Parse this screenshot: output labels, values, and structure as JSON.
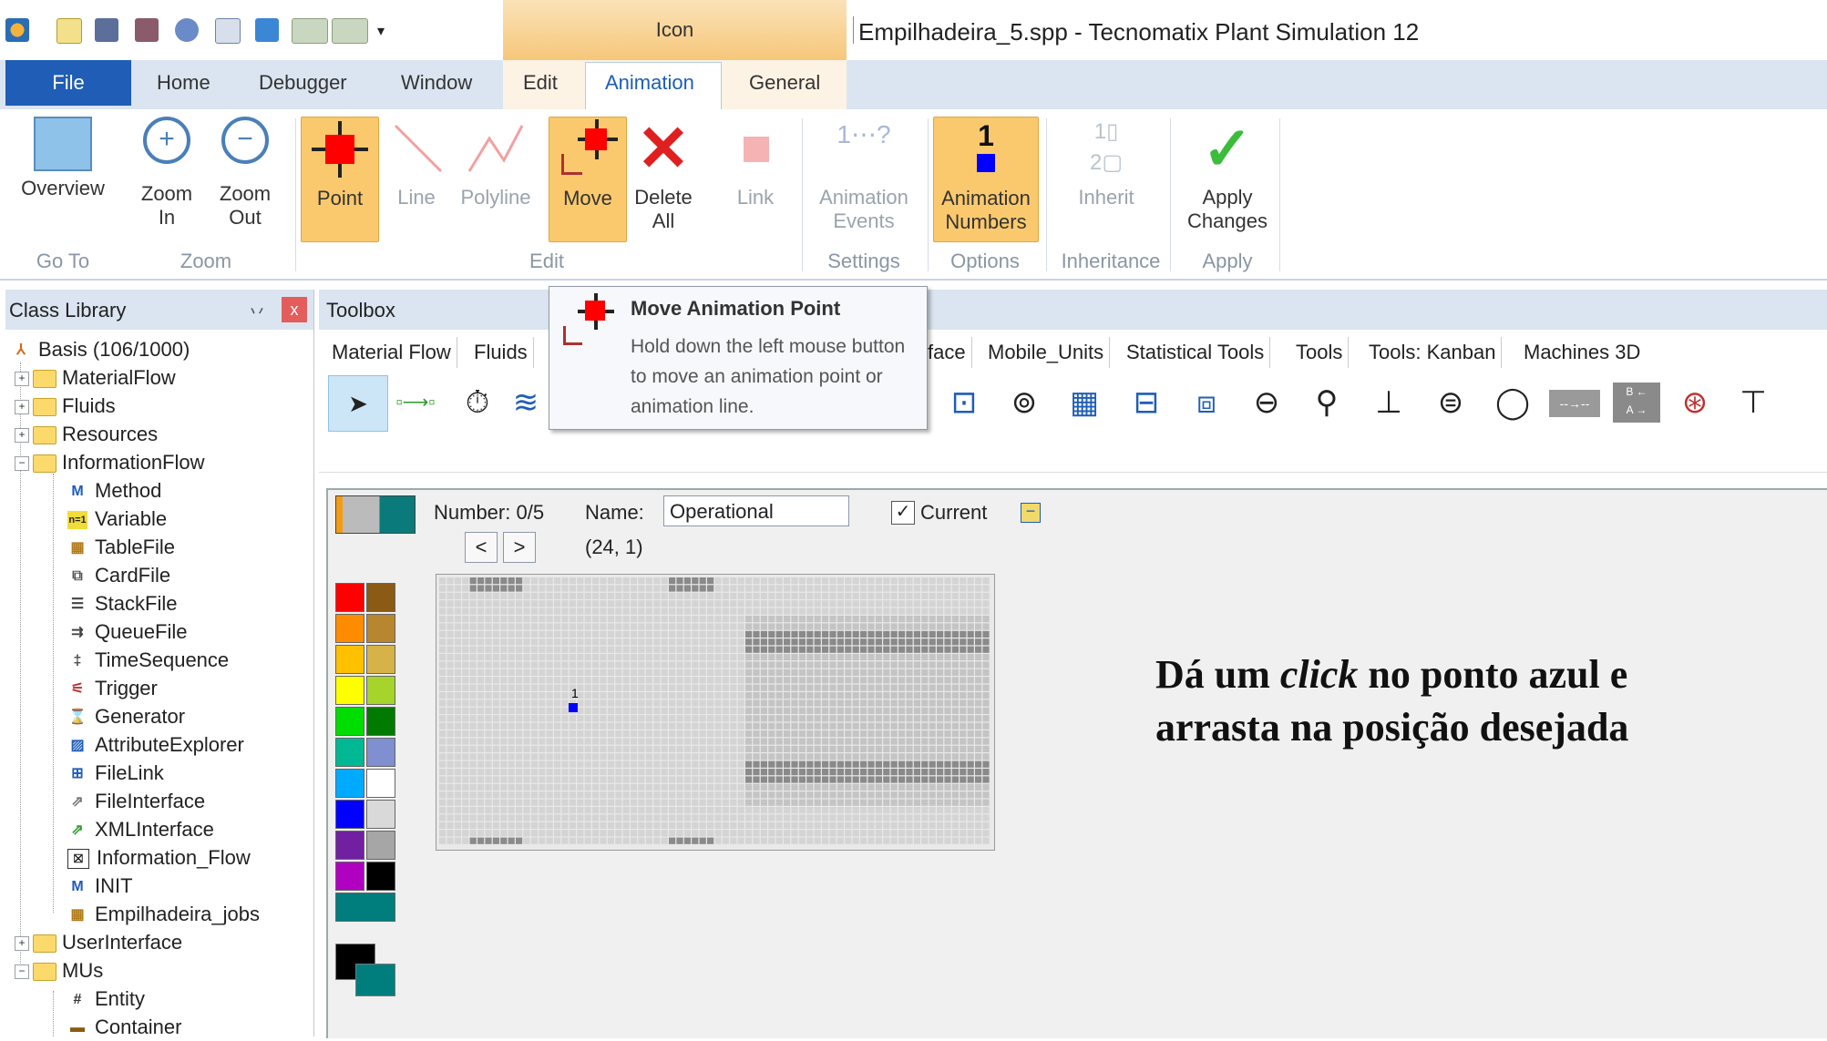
{
  "window": {
    "title": "Empilhadeira_5.spp - Tecnomatix Plant Simulation 12",
    "context_tab": "Icon"
  },
  "tabs": {
    "file": "File",
    "home": "Home",
    "debugger": "Debugger",
    "window": "Window",
    "edit": "Edit",
    "animation": "Animation",
    "general": "General"
  },
  "ribbon": {
    "overview": "Overview",
    "zoom_in_1": "Zoom",
    "zoom_in_2": "In",
    "zoom_out_1": "Zoom",
    "zoom_out_2": "Out",
    "point": "Point",
    "line": "Line",
    "polyline": "Polyline",
    "move": "Move",
    "delete_1": "Delete",
    "delete_2": "All",
    "link": "Link",
    "anim_events_1": "Animation",
    "anim_events_2": "Events",
    "anim_numbers_1": "Animation",
    "anim_numbers_2": "Numbers",
    "inherit": "Inherit",
    "apply_1": "Apply",
    "apply_2": "Changes",
    "groups": {
      "goto": "Go To",
      "zoom": "Zoom",
      "edit": "Edit",
      "settings": "Settings",
      "options": "Options",
      "inheritance": "Inheritance",
      "apply": "Apply"
    }
  },
  "class_library": {
    "title": "Class Library",
    "pin": "丷",
    "close": "x",
    "root": "Basis (106/1000)",
    "items": {
      "materialflow": "MaterialFlow",
      "fluids": "Fluids",
      "resources": "Resources",
      "informationflow": "InformationFlow",
      "method": "Method",
      "variable": "Variable",
      "tablefile": "TableFile",
      "cardfile": "CardFile",
      "stackfile": "StackFile",
      "queuefile": "QueueFile",
      "timesequence": "TimeSequence",
      "trigger": "Trigger",
      "generator": "Generator",
      "attributeexplorer": "AttributeExplorer",
      "filelink": "FileLink",
      "fileinterface": "FileInterface",
      "xmlinterface": "XMLInterface",
      "information_flow": "Information_Flow",
      "init": "INIT",
      "empilhadeira_jobs": "Empilhadeira_jobs",
      "userinterface": "UserInterface",
      "mus": "MUs",
      "entity": "Entity",
      "container": "Container"
    }
  },
  "toolbox": {
    "title": "Toolbox",
    "tabs": {
      "material_flow": "Material Flow",
      "fluids": "Fluids",
      "face": "face",
      "mobile_units": "Mobile_Units",
      "statistical_tools": "Statistical Tools",
      "tools": "Tools",
      "tools_kanban": "Tools: Kanban",
      "machines_3d": "Machines 3D"
    }
  },
  "tooltip": {
    "title": "Move Animation Point",
    "body": "Hold down the left mouse button to move an animation point or animation line."
  },
  "editor": {
    "number_label": "Number: 0/5",
    "name_label": "Name:",
    "name_value": "Operational",
    "current_label": "Current",
    "current_checked": "✓",
    "coords": "(24, 1)",
    "prev": "<",
    "next": ">",
    "point_number": "1"
  },
  "annotation": {
    "line1_a": "Dá um ",
    "line1_b": "click",
    "line1_c": " no ponto azul e",
    "line2": "arrasta na posição desejada"
  },
  "palette": [
    "#ff0000",
    "#8b5a14",
    "#ff8c00",
    "#b8862e",
    "#ffc000",
    "#d6b248",
    "#ffff00",
    "#a6d42a",
    "#00dd00",
    "#007a00",
    "#00b894",
    "#7f8fcf",
    "#00aaff",
    "#ffffff",
    "#0000ff",
    "#d9d9d9",
    "#7020a0",
    "#a6a6a6",
    "#b000c0",
    "#000000",
    "#007d7d"
  ]
}
